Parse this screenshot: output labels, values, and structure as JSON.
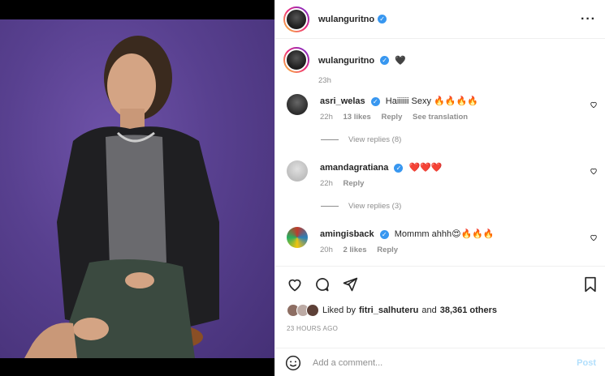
{
  "post": {
    "username": "wulanguritno",
    "caption_emoji": "🖤",
    "caption_time": "23h",
    "likes_prefix": "Liked by",
    "liked_by_user": "fitri_salhuteru",
    "and_text": "and",
    "others": "38,361 others",
    "posted_ago": "23 HOURS AGO"
  },
  "comments": [
    {
      "username": "asri_welas",
      "text": "Haiiiiii Sexy 🔥🔥🔥🔥",
      "time": "22h",
      "likes": "13 likes",
      "reply": "Reply",
      "translate": "See translation",
      "view_replies": "View replies (8)",
      "avatar_color": "#2b2b2b"
    },
    {
      "username": "amandagratiana",
      "text": "❤️❤️❤️",
      "time": "22h",
      "reply": "Reply",
      "view_replies": "View replies (3)",
      "avatar_color": "#bdbdbd"
    },
    {
      "username": "amingisback",
      "text": "Mommm ahhh😍🔥🔥🔥",
      "time": "20h",
      "likes": "2 likes",
      "reply": "Reply",
      "avatar_color": "#c0392b"
    }
  ],
  "add_comment": {
    "placeholder": "Add a comment...",
    "post_label": "Post"
  },
  "icons": [
    "heart-icon",
    "comment-icon",
    "share-icon",
    "bookmark-icon",
    "emoji-icon",
    "more-icon",
    "verified-icon"
  ],
  "colors": {
    "verified": "#3897f0",
    "post_button": "#b2dffc",
    "muted_text": "#8e8e8e",
    "photo_background": "#58408f"
  }
}
